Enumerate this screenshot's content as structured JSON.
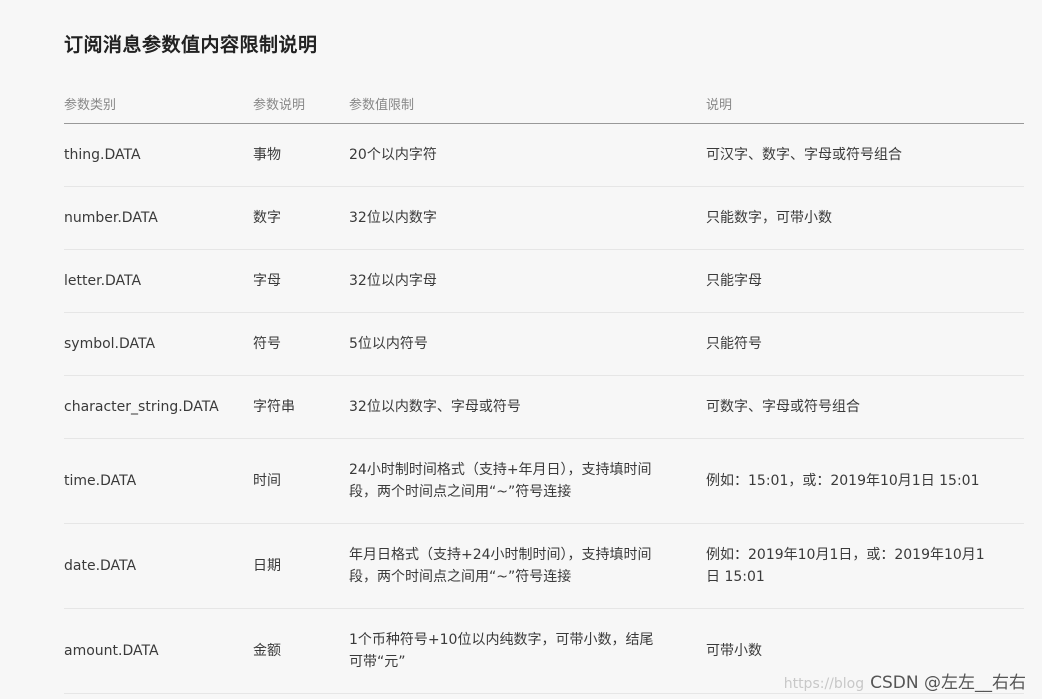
{
  "title": "订阅消息参数值内容限制说明",
  "table": {
    "headers": [
      "参数类别",
      "参数说明",
      "参数值限制",
      "说明"
    ],
    "rows": [
      {
        "category": "thing.DATA",
        "desc": "事物",
        "limit": "20个以内字符",
        "note": "可汉字、数字、字母或符号组合"
      },
      {
        "category": "number.DATA",
        "desc": "数字",
        "limit": "32位以内数字",
        "note": "只能数字，可带小数"
      },
      {
        "category": "letter.DATA",
        "desc": "字母",
        "limit": "32位以内字母",
        "note": "只能字母"
      },
      {
        "category": "symbol.DATA",
        "desc": "符号",
        "limit": "5位以内符号",
        "note": "只能符号"
      },
      {
        "category": "character_string.DATA",
        "desc": "字符串",
        "limit": "32位以内数字、字母或符号",
        "note": "可数字、字母或符号组合"
      },
      {
        "category": "time.DATA",
        "desc": "时间",
        "limit": "24小时制时间格式（支持+年月日），支持填时间段，两个时间点之间用“~”符号连接",
        "note": "例如：15:01，或：2019年10月1日 15:01"
      },
      {
        "category": "date.DATA",
        "desc": "日期",
        "limit": "年月日格式（支持+24小时制时间），支持填时间段，两个时间点之间用“~”符号连接",
        "note": "例如：2019年10月1日，或：2019年10月1日 15:01"
      },
      {
        "category": "amount.DATA",
        "desc": "金额",
        "limit": "1个币种符号+10位以内纯数字，可带小数，结尾可带“元”",
        "note": "可带小数"
      }
    ]
  },
  "watermark": {
    "url": "https://blog",
    "text": "CSDN @左左__右右"
  }
}
